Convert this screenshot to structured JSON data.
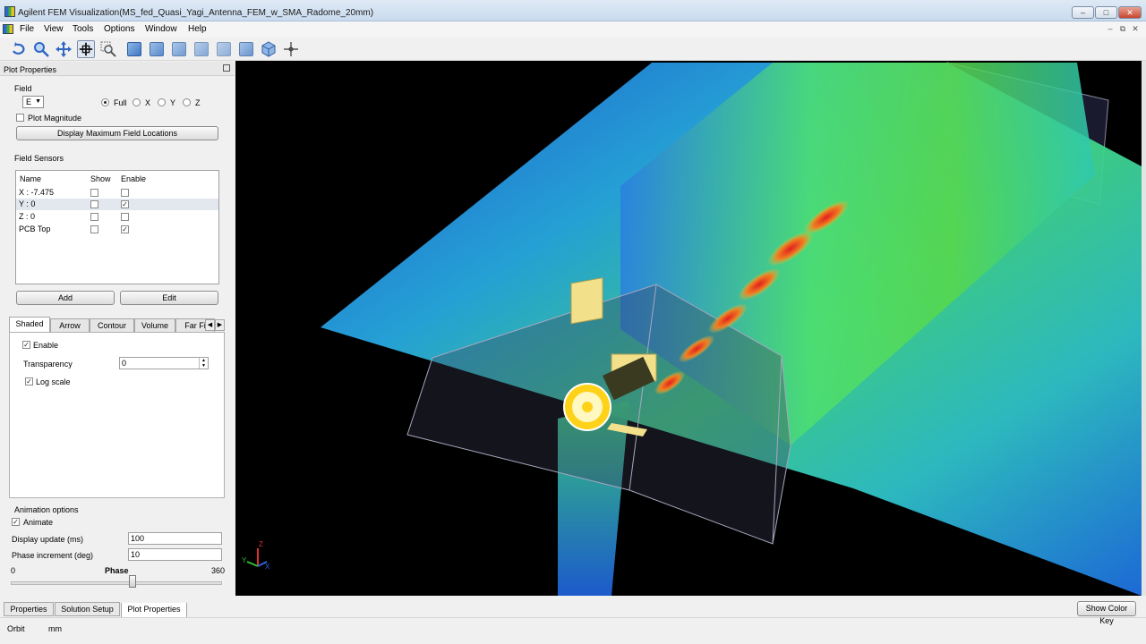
{
  "window": {
    "title": "Agilent FEM Visualization(MS_fed_Quasi_Yagi_Antenna_FEM_w_SMA_Radome_20mm)",
    "minimize": "‒",
    "maximize": "□",
    "close": "✕"
  },
  "menu": [
    "File",
    "View",
    "Tools",
    "Options",
    "Window",
    "Help"
  ],
  "mdi_controls": [
    "–",
    "⧉",
    "✕"
  ],
  "toolbar": {
    "icons": [
      "orbit-icon",
      "zoom-icon",
      "pan-icon",
      "select-icon",
      "zoom-box-icon",
      "view-front-icon",
      "view-back-icon",
      "view-top-icon",
      "view-bottom-icon",
      "view-left-icon",
      "view-right-icon",
      "view-iso-icon",
      "crosshair-icon"
    ]
  },
  "panel": {
    "title": "Plot Properties",
    "field_label": "Field",
    "field_value": "E",
    "component_options": [
      "Full",
      "X",
      "Y",
      "Z"
    ],
    "component_selected": "Full",
    "plot_magnitude": "Plot Magnitude",
    "display_max_button": "Display Maximum Field Locations",
    "sensors_label": "Field Sensors",
    "sensor_columns": [
      "Name",
      "Show",
      "Enable"
    ],
    "sensors": [
      {
        "name": "X : -7.475",
        "show": false,
        "enable": false
      },
      {
        "name": "Y : 0",
        "show": false,
        "enable": true
      },
      {
        "name": "Z : 0",
        "show": false,
        "enable": false
      },
      {
        "name": "PCB Top",
        "show": false,
        "enable": true
      }
    ],
    "add_button": "Add",
    "edit_button": "Edit",
    "plot_tabs": [
      "Shaded",
      "Arrow",
      "Contour",
      "Volume",
      "Far Fi"
    ],
    "active_plot_tab": "Shaded",
    "enable_label": "Enable",
    "transparency_label": "Transparency",
    "transparency_value": "0",
    "log_scale_label": "Log scale",
    "animation_label": "Animation options",
    "animate_label": "Animate",
    "display_update_label": "Display update (ms)",
    "display_update_value": "100",
    "phase_increment_label": "Phase increment (deg)",
    "phase_increment_value": "10",
    "phase_label": "Phase",
    "phase_min": "0",
    "phase_max": "360",
    "phase_value": 0.58
  },
  "bottom_tabs": [
    "Properties",
    "Solution Setup",
    "Plot Properties"
  ],
  "active_bottom_tab": "Plot Properties",
  "status": {
    "mode": "Orbit",
    "units": "mm",
    "color_key_button": "Show Color Key"
  },
  "axis_labels": [
    "Z",
    "Y",
    "X"
  ],
  "colors": {
    "viewport_bg": "#000000",
    "field_low": "#1e5fd6",
    "field_mid": "#36d66a",
    "field_high": "#e02020"
  }
}
